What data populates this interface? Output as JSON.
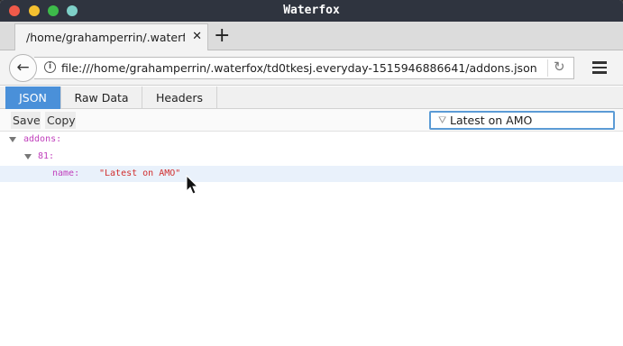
{
  "window": {
    "title": "Waterfox"
  },
  "tabs": [
    {
      "label": "/home/grahamperrin/.waterfox"
    }
  ],
  "navbar": {
    "url": "file:///home/grahamperrin/.waterfox/td0tkesj.everyday-1515946886641/addons.json"
  },
  "viewer": {
    "tabs": [
      "JSON",
      "Raw Data",
      "Headers"
    ],
    "active_tab": "JSON",
    "toolbar": {
      "save_label": "Save",
      "copy_label": "Copy"
    },
    "filter": {
      "value": "Latest on AMO"
    },
    "tree": [
      {
        "key": "addons:",
        "value": ""
      },
      {
        "key": "81:",
        "value": ""
      },
      {
        "key": "name:",
        "value": "\"Latest on AMO\""
      }
    ]
  },
  "colors": {
    "accent": "#4a90d9",
    "key": "#c03fbc",
    "string": "#d12e2e",
    "titlebar": "#2f343f"
  }
}
